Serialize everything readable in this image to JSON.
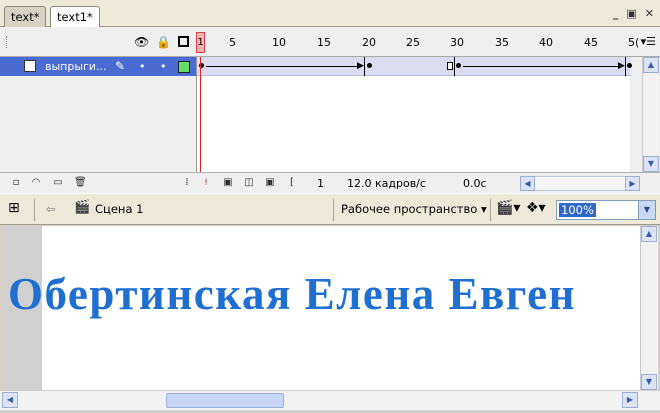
{
  "tabs": [
    {
      "label": "text*"
    },
    {
      "label": "text1*"
    }
  ],
  "timeline": {
    "ruler": [
      "1",
      "5",
      "10",
      "15",
      "20",
      "25",
      "30",
      "35",
      "40",
      "45",
      "5("
    ],
    "layer": {
      "name": "выпрыги..."
    },
    "footer": {
      "current_frame": "1",
      "fps": "12.0 кадров/с",
      "time": "0.0с"
    }
  },
  "editbar": {
    "scene": "Сцена 1",
    "workspace": "Рабочее пространство",
    "zoom": "100%"
  },
  "stage": {
    "text": "Обертинская Елена Евген"
  },
  "colors": {
    "stage_text": "#1f6fd0",
    "layer_selected": "#4a6cd2",
    "layer_outline": "#66dd66",
    "playhead": "#e02020"
  }
}
